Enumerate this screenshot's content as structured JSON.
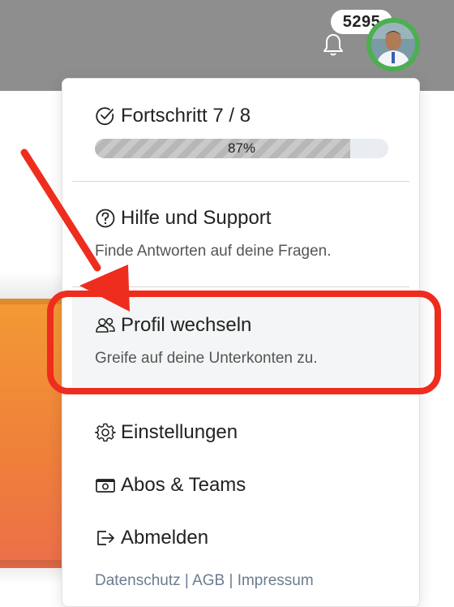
{
  "header": {
    "notification_count": "5295",
    "avatar_ring_color": "#4caf50"
  },
  "menu": {
    "progress": {
      "title": "Fortschritt 7 / 8",
      "percent_label": "87%",
      "value": 0.87,
      "icon": "check-circle-icon"
    },
    "help": {
      "title": "Hilfe und Support",
      "subtitle": "Finde Antworten auf deine Fragen.",
      "icon": "question-circle-icon"
    },
    "switch_profile": {
      "title": "Profil wechseln",
      "subtitle": "Greife auf deine Unterkonten zu.",
      "icon": "users-icon"
    },
    "settings": {
      "title": "Einstellungen",
      "icon": "gear-icon"
    },
    "subscriptions": {
      "title": "Abos & Teams",
      "icon": "money-icon"
    },
    "logout": {
      "title": "Abmelden",
      "icon": "logout-icon"
    },
    "footer": {
      "privacy": "Datenschutz",
      "sep1": " | ",
      "terms": "AGB",
      "sep2": " | ",
      "imprint": "Impressum"
    }
  },
  "annotation": {
    "color": "#ee2d1e"
  }
}
